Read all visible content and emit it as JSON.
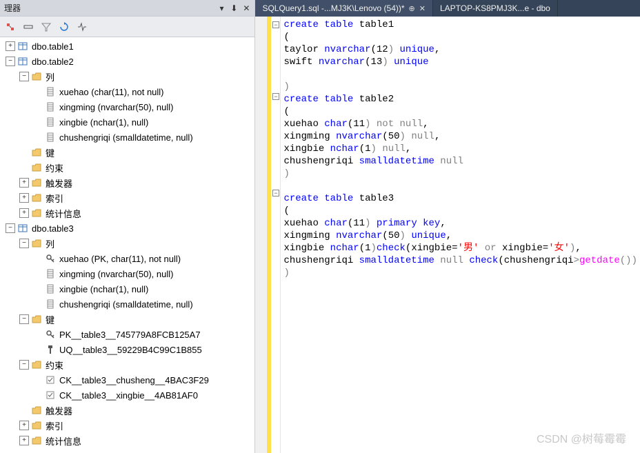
{
  "panel": {
    "title": "理器",
    "pin": "📌",
    "close": "✕"
  },
  "tabs": [
    {
      "label": "SQLQuery1.sql -...MJ3K\\Lenovo (54))*",
      "active": true
    },
    {
      "label": "LAPTOP-KS8PMJ3K...e - dbo",
      "active": false
    }
  ],
  "tree": {
    "items": [
      {
        "depth": 0,
        "exp": "+",
        "icon": "table",
        "label": "dbo.table1"
      },
      {
        "depth": 0,
        "exp": "-",
        "icon": "table",
        "label": "dbo.table2"
      },
      {
        "depth": 1,
        "exp": "-",
        "icon": "folder",
        "label": "列"
      },
      {
        "depth": 2,
        "exp": "",
        "icon": "column",
        "label": "xuehao (char(11), not null)"
      },
      {
        "depth": 2,
        "exp": "",
        "icon": "column",
        "label": "xingming (nvarchar(50), null)"
      },
      {
        "depth": 2,
        "exp": "",
        "icon": "column",
        "label": "xingbie (nchar(1), null)"
      },
      {
        "depth": 2,
        "exp": "",
        "icon": "column",
        "label": "chushengriqi (smalldatetime, null)"
      },
      {
        "depth": 1,
        "exp": "",
        "icon": "folder",
        "label": "键"
      },
      {
        "depth": 1,
        "exp": "",
        "icon": "folder",
        "label": "约束"
      },
      {
        "depth": 1,
        "exp": "+",
        "icon": "folder",
        "label": "触发器"
      },
      {
        "depth": 1,
        "exp": "+",
        "icon": "folder",
        "label": "索引"
      },
      {
        "depth": 1,
        "exp": "+",
        "icon": "folder",
        "label": "统计信息"
      },
      {
        "depth": 0,
        "exp": "-",
        "icon": "table",
        "label": "dbo.table3"
      },
      {
        "depth": 1,
        "exp": "-",
        "icon": "folder",
        "label": "列"
      },
      {
        "depth": 2,
        "exp": "",
        "icon": "key",
        "label": "xuehao (PK, char(11), not null)"
      },
      {
        "depth": 2,
        "exp": "",
        "icon": "column",
        "label": "xingming (nvarchar(50), null)"
      },
      {
        "depth": 2,
        "exp": "",
        "icon": "column",
        "label": "xingbie (nchar(1), null)"
      },
      {
        "depth": 2,
        "exp": "",
        "icon": "column",
        "label": "chushengriqi (smalldatetime, null)"
      },
      {
        "depth": 1,
        "exp": "-",
        "icon": "folder",
        "label": "键"
      },
      {
        "depth": 2,
        "exp": "",
        "icon": "key",
        "label": "PK__table3__745779A8FCB125A7"
      },
      {
        "depth": 2,
        "exp": "",
        "icon": "uq",
        "label": "UQ__table3__59229B4C99C1B855"
      },
      {
        "depth": 1,
        "exp": "-",
        "icon": "folder",
        "label": "约束"
      },
      {
        "depth": 2,
        "exp": "",
        "icon": "check",
        "label": "CK__table3__chusheng__4BAC3F29"
      },
      {
        "depth": 2,
        "exp": "",
        "icon": "check",
        "label": "CK__table3__xingbie__4AB81AF0"
      },
      {
        "depth": 1,
        "exp": "",
        "icon": "folder",
        "label": "触发器"
      },
      {
        "depth": 1,
        "exp": "+",
        "icon": "folder",
        "label": "索引"
      },
      {
        "depth": 1,
        "exp": "+",
        "icon": "folder",
        "label": "统计信息"
      }
    ]
  },
  "code": {
    "lines": [
      {
        "tokens": [
          {
            "t": "create",
            "c": "kw-blue"
          },
          {
            "t": " "
          },
          {
            "t": "table",
            "c": "kw-blue"
          },
          {
            "t": " table1"
          }
        ],
        "fold": "-"
      },
      {
        "tokens": [
          {
            "t": "("
          },
          {
            "t": ""
          }
        ],
        "fold": ""
      },
      {
        "tokens": [
          {
            "t": "taylor "
          },
          {
            "t": "nvarchar",
            "c": "kw-blue"
          },
          {
            "t": "("
          },
          {
            "t": "12"
          },
          {
            "t": ")",
            "c": "kw-gray"
          },
          {
            "t": " "
          },
          {
            "t": "unique",
            "c": "kw-blue"
          },
          {
            "t": ","
          }
        ],
        "fold": ""
      },
      {
        "tokens": [
          {
            "t": "swift "
          },
          {
            "t": "nvarchar",
            "c": "kw-blue"
          },
          {
            "t": "("
          },
          {
            "t": "13"
          },
          {
            "t": ")",
            "c": "kw-gray"
          },
          {
            "t": " "
          },
          {
            "t": "unique",
            "c": "kw-blue"
          }
        ],
        "fold": ""
      },
      {
        "tokens": [
          {
            "t": ""
          }
        ],
        "fold": ""
      },
      {
        "tokens": [
          {
            "t": ")",
            "c": "kw-gray"
          }
        ],
        "fold": ""
      },
      {
        "tokens": [
          {
            "t": "create",
            "c": "kw-blue"
          },
          {
            "t": " "
          },
          {
            "t": "table",
            "c": "kw-blue"
          },
          {
            "t": " table2"
          }
        ],
        "fold": "-"
      },
      {
        "tokens": [
          {
            "t": "("
          },
          {
            "t": ""
          }
        ],
        "fold": ""
      },
      {
        "tokens": [
          {
            "t": "xuehao "
          },
          {
            "t": "char",
            "c": "kw-blue"
          },
          {
            "t": "("
          },
          {
            "t": "11"
          },
          {
            "t": ")",
            "c": "kw-gray"
          },
          {
            "t": " "
          },
          {
            "t": "not",
            "c": "kw-gray"
          },
          {
            "t": " "
          },
          {
            "t": "null",
            "c": "kw-gray"
          },
          {
            "t": ","
          }
        ],
        "fold": ""
      },
      {
        "tokens": [
          {
            "t": "xingming "
          },
          {
            "t": "nvarchar",
            "c": "kw-blue"
          },
          {
            "t": "("
          },
          {
            "t": "50"
          },
          {
            "t": ")",
            "c": "kw-gray"
          },
          {
            "t": " "
          },
          {
            "t": "null",
            "c": "kw-gray"
          },
          {
            "t": ","
          }
        ],
        "fold": ""
      },
      {
        "tokens": [
          {
            "t": "xingbie "
          },
          {
            "t": "nchar",
            "c": "kw-blue"
          },
          {
            "t": "("
          },
          {
            "t": "1"
          },
          {
            "t": ")",
            "c": "kw-gray"
          },
          {
            "t": " "
          },
          {
            "t": "null",
            "c": "kw-gray"
          },
          {
            "t": ","
          }
        ],
        "fold": ""
      },
      {
        "tokens": [
          {
            "t": "chushengriqi "
          },
          {
            "t": "smalldatetime",
            "c": "kw-blue"
          },
          {
            "t": " "
          },
          {
            "t": "null",
            "c": "kw-gray"
          }
        ],
        "fold": ""
      },
      {
        "tokens": [
          {
            "t": ")",
            "c": "kw-gray"
          }
        ],
        "fold": ""
      },
      {
        "tokens": [
          {
            "t": ""
          }
        ],
        "fold": ""
      },
      {
        "tokens": [
          {
            "t": "create",
            "c": "kw-blue"
          },
          {
            "t": " "
          },
          {
            "t": "table",
            "c": "kw-blue"
          },
          {
            "t": " table3"
          }
        ],
        "fold": "-"
      },
      {
        "tokens": [
          {
            "t": "("
          },
          {
            "t": ""
          }
        ],
        "fold": ""
      },
      {
        "tokens": [
          {
            "t": "xuehao "
          },
          {
            "t": "char",
            "c": "kw-blue"
          },
          {
            "t": "("
          },
          {
            "t": "11"
          },
          {
            "t": ")",
            "c": "kw-gray"
          },
          {
            "t": " "
          },
          {
            "t": "primary",
            "c": "kw-blue"
          },
          {
            "t": " "
          },
          {
            "t": "key",
            "c": "kw-blue"
          },
          {
            "t": ","
          }
        ],
        "fold": ""
      },
      {
        "tokens": [
          {
            "t": "xingming "
          },
          {
            "t": "nvarchar",
            "c": "kw-blue"
          },
          {
            "t": "("
          },
          {
            "t": "50"
          },
          {
            "t": ")",
            "c": "kw-gray"
          },
          {
            "t": " "
          },
          {
            "t": "unique",
            "c": "kw-blue"
          },
          {
            "t": ","
          }
        ],
        "fold": ""
      },
      {
        "tokens": [
          {
            "t": "xingbie "
          },
          {
            "t": "nchar",
            "c": "kw-blue"
          },
          {
            "t": "("
          },
          {
            "t": "1"
          },
          {
            "t": ")",
            "c": "kw-gray"
          },
          {
            "t": "check",
            "c": "kw-blue"
          },
          {
            "t": "("
          },
          {
            "t": "xingbie"
          },
          {
            "t": "="
          },
          {
            "t": "'男'",
            "c": "kw-red"
          },
          {
            "t": " "
          },
          {
            "t": "or",
            "c": "kw-gray"
          },
          {
            "t": " xingbie"
          },
          {
            "t": "="
          },
          {
            "t": "'女'",
            "c": "kw-red"
          },
          {
            "t": ")",
            "c": "kw-gray"
          },
          {
            "t": ","
          }
        ],
        "fold": ""
      },
      {
        "tokens": [
          {
            "t": "chushengriqi "
          },
          {
            "t": "smalldatetime",
            "c": "kw-blue"
          },
          {
            "t": " "
          },
          {
            "t": "null",
            "c": "kw-gray"
          },
          {
            "t": " "
          },
          {
            "t": "check",
            "c": "kw-blue"
          },
          {
            "t": "("
          },
          {
            "t": "chushengriqi"
          },
          {
            "t": ">",
            "c": "kw-gray"
          },
          {
            "t": "getdate",
            "c": "kw-magenta"
          },
          {
            "t": "())",
            "c": "kw-gray"
          }
        ],
        "fold": ""
      },
      {
        "tokens": [
          {
            "t": ")",
            "c": "kw-gray"
          }
        ],
        "fold": ""
      }
    ]
  },
  "watermark": "CSDN @树莓霉霉"
}
